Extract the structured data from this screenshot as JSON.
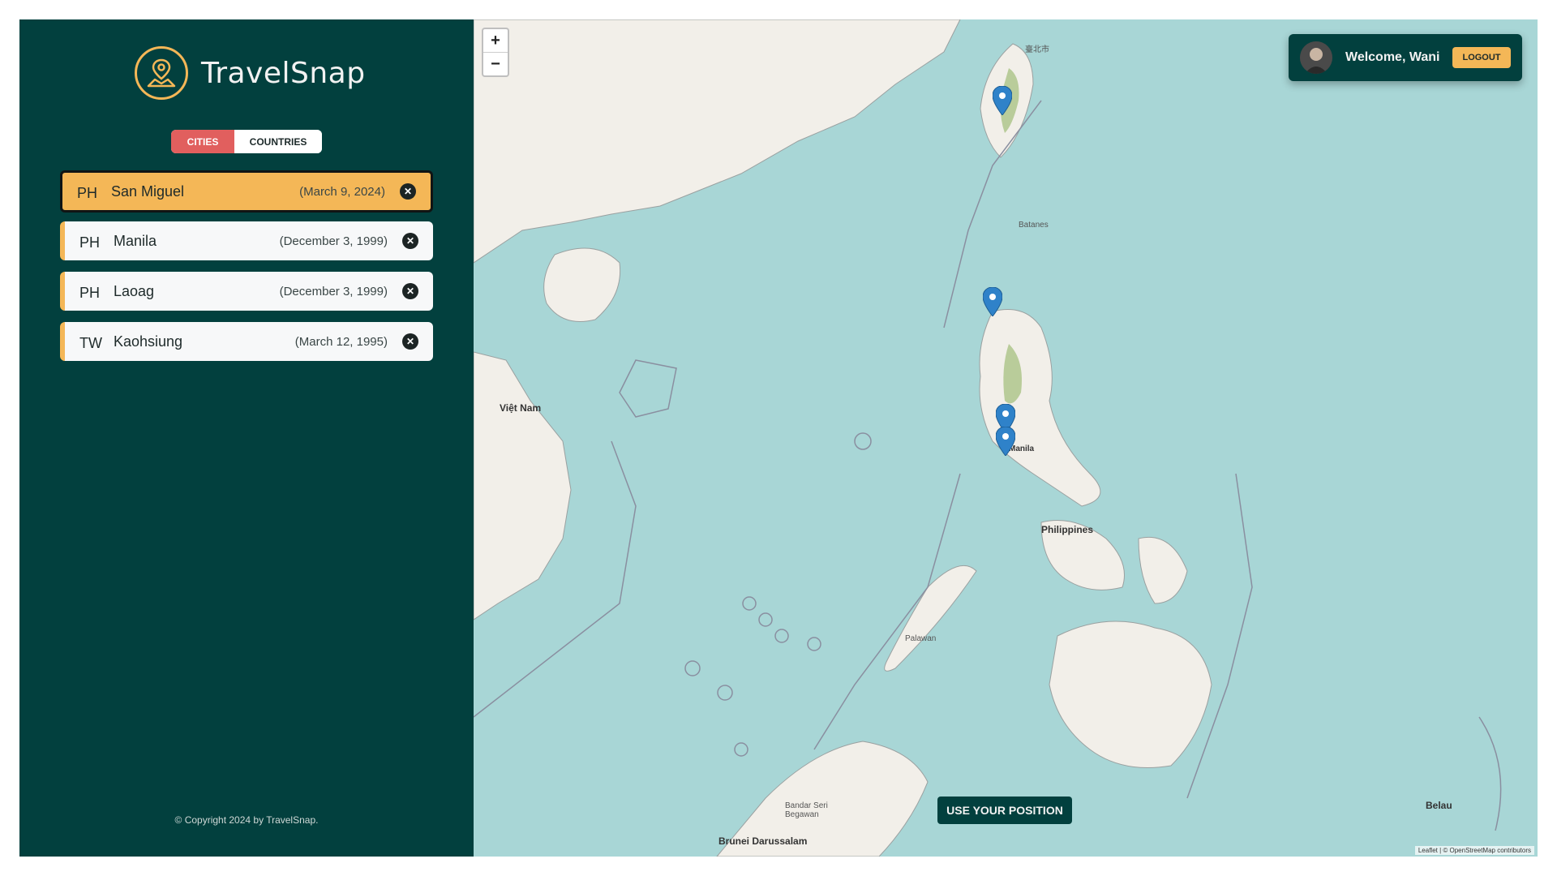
{
  "app": {
    "name": "TravelSnap"
  },
  "tabs": {
    "cities": "CITIES",
    "countries": "COUNTRIES"
  },
  "cities": [
    {
      "code": "PH",
      "name": "San Miguel",
      "date": "(March 9, 2024)"
    },
    {
      "code": "PH",
      "name": "Manila",
      "date": "(December 3, 1999)"
    },
    {
      "code": "PH",
      "name": "Laoag",
      "date": "(December 3, 1999)"
    },
    {
      "code": "TW",
      "name": "Kaohsiung",
      "date": "(March 12, 1995)"
    }
  ],
  "footer": {
    "copyright": "© Copyright 2024 by TravelSnap."
  },
  "user": {
    "welcome": "Welcome, Wani",
    "logout": "LOGOUT"
  },
  "map": {
    "zoom_in": "+",
    "zoom_out": "−",
    "use_position": "USE YOUR POSITION",
    "labels": {
      "philippines": "Philippines",
      "viet_nam": "Việt Nam",
      "manila": "Manila",
      "brunei": "Brunei Darussalam",
      "bandar": "Bandar Seri Begawan",
      "belau": "Belau",
      "taipei": "臺北市",
      "palawan": "Palawan",
      "batanes": "Batanes"
    },
    "attribution": "Leaflet | © OpenStreetMap contributors"
  },
  "colors": {
    "sidebar": "#02403e",
    "accent": "#f4b757",
    "active_tab": "#e15f5e",
    "sea": "#a8d6d6",
    "land": "#f2efe9"
  }
}
